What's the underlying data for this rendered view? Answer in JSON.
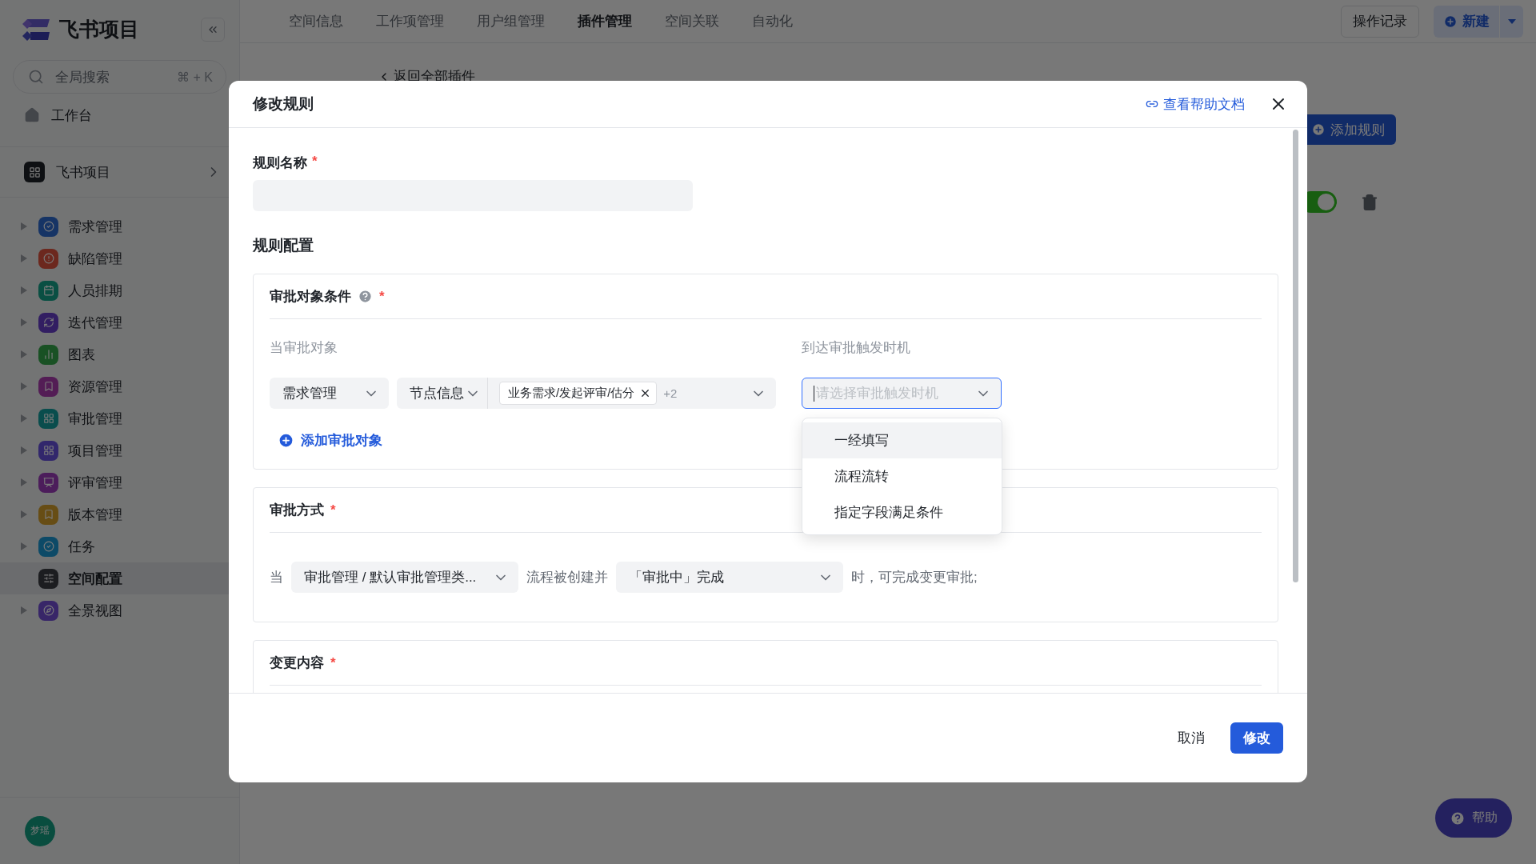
{
  "sidebar": {
    "brand": "飞书项目",
    "search": {
      "placeholder": "全局搜索",
      "shortcut": "⌘ + K"
    },
    "workbench": "工作台",
    "space": "飞书项目",
    "items": [
      {
        "label": "需求管理",
        "color": "#163465",
        "kind": "group",
        "selected": false
      },
      {
        "label": "缺陷管理",
        "color": "#6c281e",
        "kind": "group",
        "selected": false
      },
      {
        "label": "人员排期",
        "color": "#0a4f43",
        "kind": "group",
        "selected": false
      },
      {
        "label": "迭代管理",
        "color": "#321e62",
        "kind": "group",
        "selected": false
      },
      {
        "label": "图表",
        "color": "#195124",
        "kind": "group",
        "selected": false
      },
      {
        "label": "资源管理",
        "color": "#531d55",
        "kind": "group",
        "selected": false
      },
      {
        "label": "审批管理",
        "color": "#094d4d",
        "kind": "group",
        "selected": false
      },
      {
        "label": "项目管理",
        "color": "#32276c",
        "kind": "group",
        "selected": false
      },
      {
        "label": "评审管理",
        "color": "#4c1d5b",
        "kind": "group",
        "selected": false
      },
      {
        "label": "版本管理",
        "color": "#674d15",
        "kind": "group",
        "selected": false
      },
      {
        "label": "任务",
        "color": "#0d4a67",
        "kind": "group",
        "selected": false
      },
      {
        "label": "空间配置",
        "color": "#1c1d20",
        "kind": "page",
        "selected": true
      },
      {
        "label": "全景视图",
        "color": "#382668",
        "kind": "group",
        "selected": false
      }
    ],
    "user": "梦瑶"
  },
  "top_nav": {
    "tabs": [
      {
        "label": "空间信息",
        "selected": false
      },
      {
        "label": "工作项管理",
        "selected": false
      },
      {
        "label": "用户组管理",
        "selected": false
      },
      {
        "label": "插件管理",
        "selected": true
      },
      {
        "label": "空间关联",
        "selected": false
      },
      {
        "label": "自动化",
        "selected": false
      }
    ],
    "history_button": "操作记录",
    "new_button": "新建"
  },
  "page": {
    "back_link": "返回全部插件",
    "add_rule_button": "添加规则",
    "rule_on": true
  },
  "help_button": "帮助",
  "modal": {
    "title": "修改规则",
    "help_link": "查看帮助文档",
    "name_field": {
      "label": "规则名称",
      "required_mark": "*"
    },
    "config_heading": "规则配置",
    "object_condition": {
      "title": "审批对象条件",
      "required_mark": "*",
      "object_label": "当审批对象",
      "trigger_label": "到达审批触发时机",
      "work_item_select": "需求管理",
      "field_select": "节点信息",
      "tags": [
        "业务需求/发起评审/估分"
      ],
      "more_count": "+2",
      "trigger_select": {
        "placeholder": "请选择审批触发时机",
        "focused": true,
        "open": true,
        "options": [
          {
            "label": "一经填写",
            "highlighted": true
          },
          {
            "label": "流程流转",
            "highlighted": false
          },
          {
            "label": "指定字段满足条件",
            "highlighted": false
          }
        ]
      },
      "add_link": "添加审批对象"
    },
    "approval_method": {
      "title": "审批方式",
      "required_mark": "*",
      "sentence": [
        {
          "kind": "text",
          "text": "当"
        },
        {
          "kind": "select",
          "text": "审批管理 / 默认审批管理类..."
        },
        {
          "kind": "text",
          "text": "流程被创建并"
        },
        {
          "kind": "select",
          "text": "「审批中」完成"
        },
        {
          "kind": "text",
          "text": "时，可完成变更审批;"
        }
      ]
    },
    "change_content": {
      "title": "变更内容",
      "required_mark": "*"
    },
    "buttons": [
      {
        "label": "取消",
        "kind": "secondary"
      },
      {
        "label": "修改",
        "kind": "primary"
      }
    ]
  }
}
